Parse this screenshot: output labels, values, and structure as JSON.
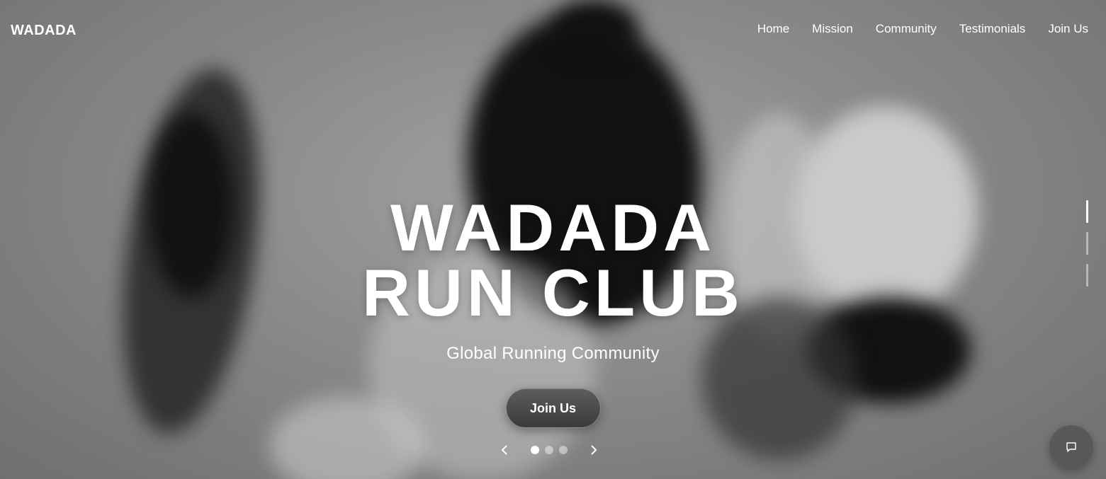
{
  "header": {
    "brand": "WADADA",
    "nav": [
      "Home",
      "Mission",
      "Community",
      "Testimonials",
      "Join Us"
    ]
  },
  "hero": {
    "title_line1": "WADADA",
    "title_line2": "RUN CLUB",
    "subtitle": "Global Running Community",
    "cta_label": "Join Us"
  },
  "carousel": {
    "slides": 3,
    "active_index": 0,
    "prev_icon": "chevron-left-icon",
    "next_icon": "chevron-right-icon"
  },
  "section_indicator": {
    "count": 3,
    "active_index": 0
  },
  "chat": {
    "icon": "chat-icon"
  }
}
